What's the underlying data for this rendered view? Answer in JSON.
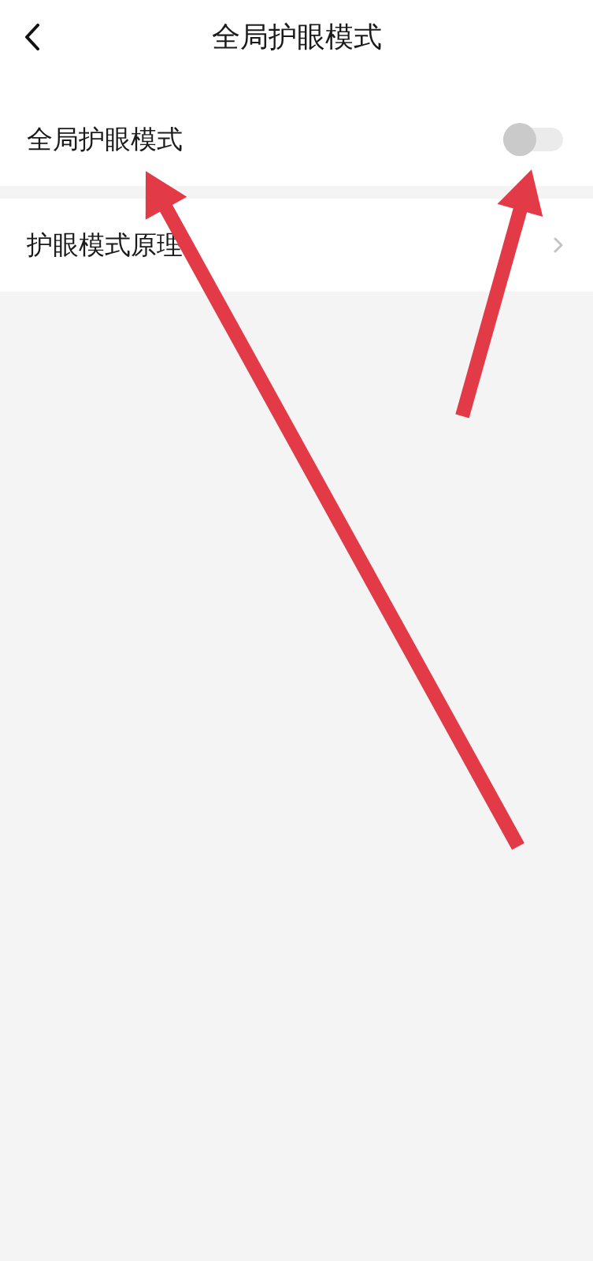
{
  "header": {
    "title": "全局护眼模式"
  },
  "settings": [
    {
      "kind": "toggle",
      "label": "全局护眼模式",
      "on": false
    },
    {
      "kind": "link",
      "label": "护眼模式原理"
    }
  ],
  "annotations": [
    {
      "kind": "arrow"
    },
    {
      "kind": "arrow"
    }
  ]
}
